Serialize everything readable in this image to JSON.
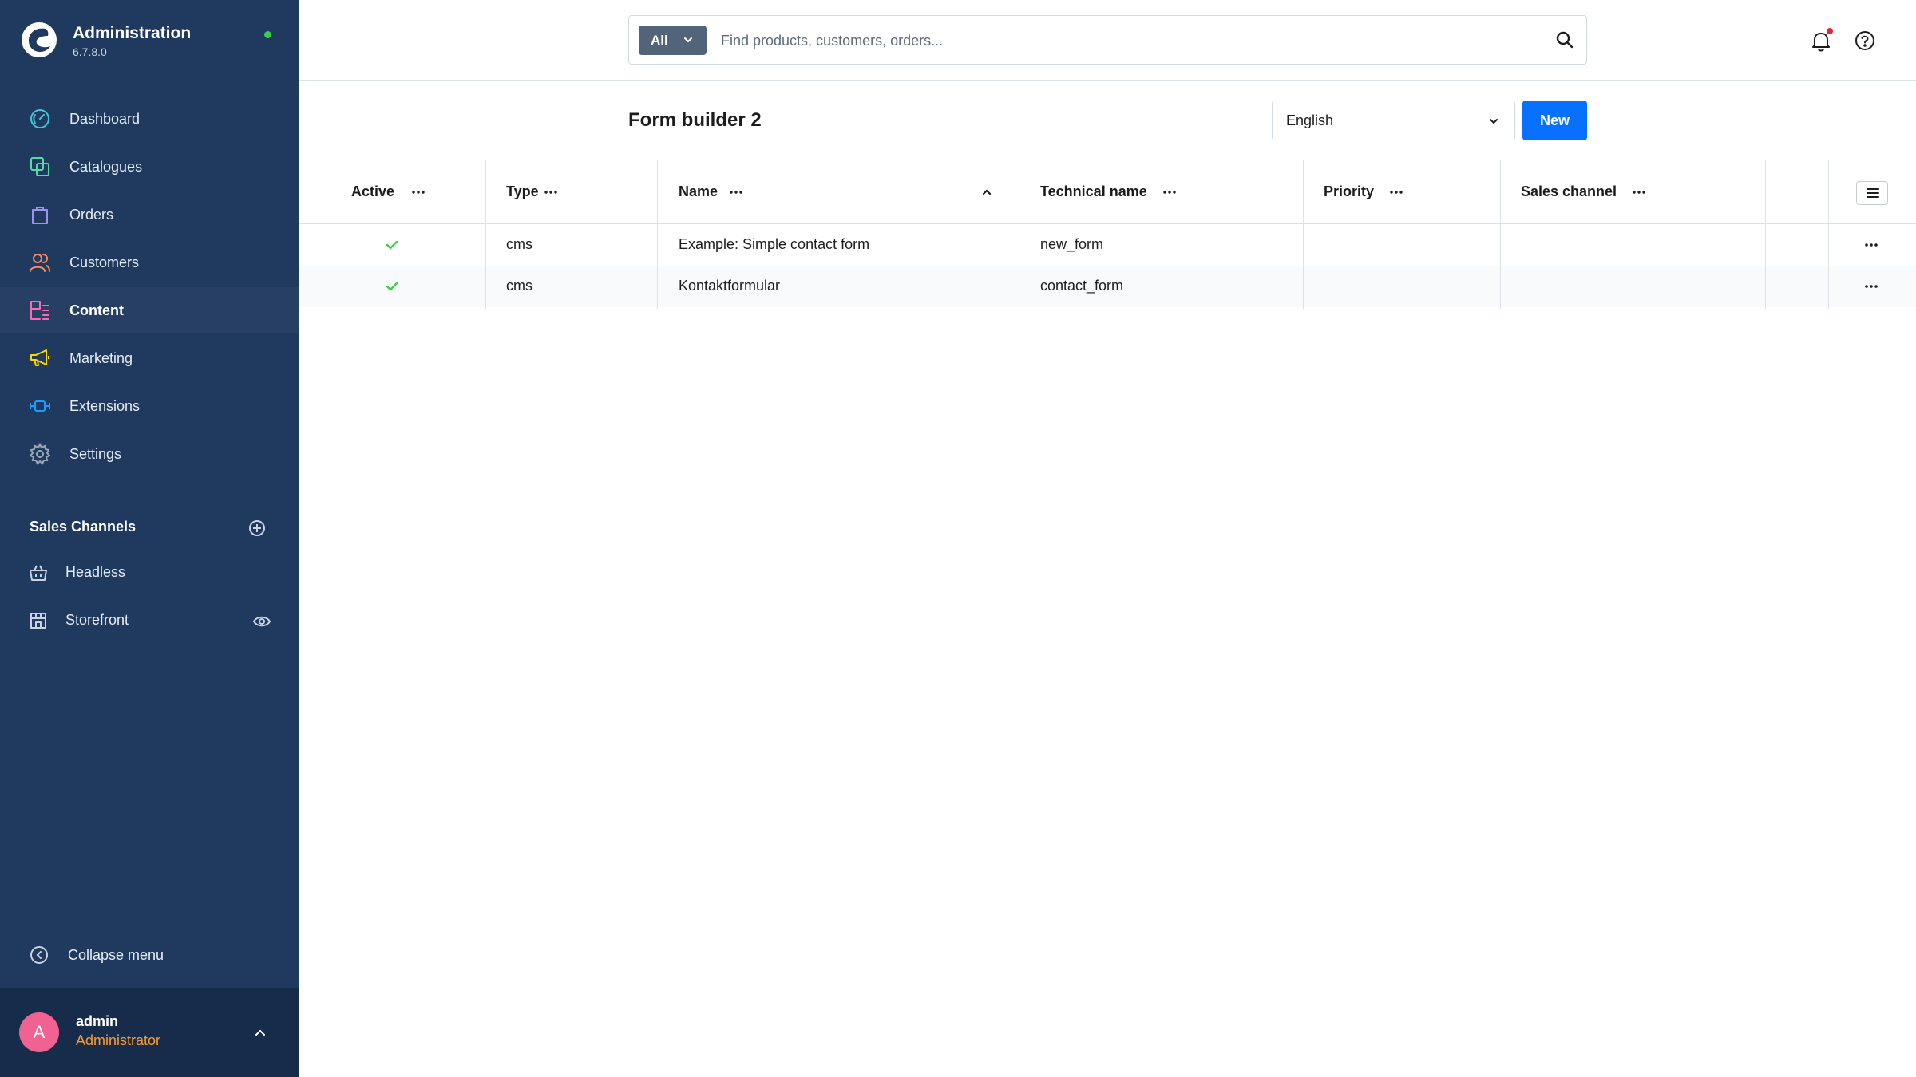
{
  "app": {
    "title": "Administration",
    "version": "6.7.8.0",
    "status_color": "#37d046"
  },
  "sidebar": {
    "nav": [
      {
        "label": "Dashboard",
        "icon": "gauge-icon",
        "color": "#44c4d6"
      },
      {
        "label": "Catalogues",
        "icon": "catalogue-icon",
        "color": "#57d9a3"
      },
      {
        "label": "Orders",
        "icon": "shopping-bag-icon",
        "color": "#a092f0"
      },
      {
        "label": "Customers",
        "icon": "users-icon",
        "color": "#f88962"
      },
      {
        "label": "Content",
        "icon": "content-icon",
        "color": "#ff68b4",
        "active": true
      },
      {
        "label": "Marketing",
        "icon": "megaphone-icon",
        "color": "#ffd700"
      },
      {
        "label": "Extensions",
        "icon": "plug-icon",
        "color": "#189eff"
      },
      {
        "label": "Settings",
        "icon": "gear-icon",
        "color": "#9aa8b5"
      }
    ],
    "sales_channels_title": "Sales Channels",
    "sales_channels": [
      {
        "label": "Headless",
        "icon": "basket-icon"
      },
      {
        "label": "Storefront",
        "icon": "storefront-icon",
        "has_eye": true
      }
    ],
    "collapse_label": "Collapse menu",
    "user": {
      "initial": "A",
      "name": "admin",
      "role": "Administrator"
    }
  },
  "topbar": {
    "search_type": "All",
    "search_placeholder": "Find products, customers, orders...",
    "notification_dot_color": "#e3262f"
  },
  "page": {
    "title": "Form builder 2",
    "language": "English",
    "new_label": "New"
  },
  "grid": {
    "columns": [
      "Active",
      "Type",
      "Name",
      "Technical name",
      "Priority",
      "Sales channel"
    ],
    "sorted_column": "Name",
    "sort_direction": "ascending",
    "rows": [
      {
        "active": true,
        "type": "cms",
        "name": "Example: Simple contact form",
        "technical_name": "new_form",
        "priority": "",
        "sales_channel": ""
      },
      {
        "active": true,
        "type": "cms",
        "name": "Kontaktformular",
        "technical_name": "contact_form",
        "priority": "",
        "sales_channel": ""
      }
    ]
  }
}
